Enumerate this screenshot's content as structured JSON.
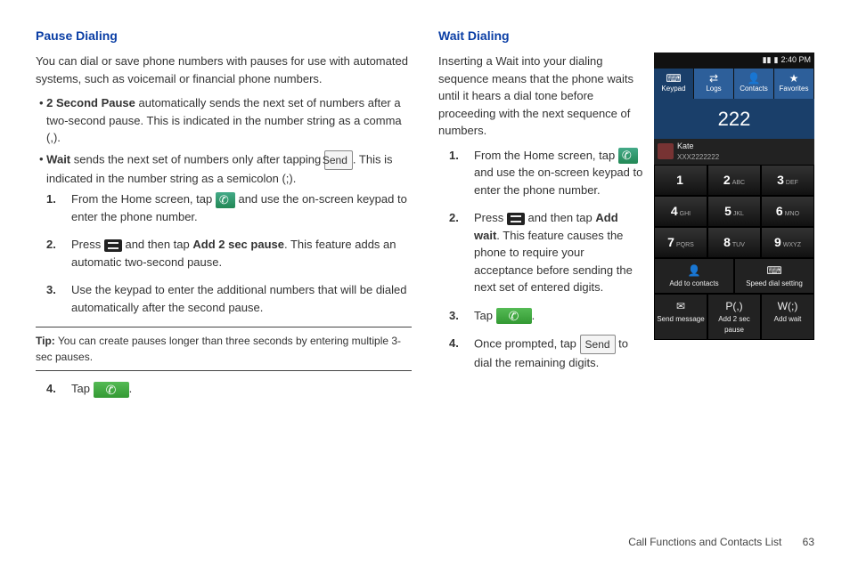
{
  "left": {
    "heading": "Pause Dialing",
    "intro": "You can dial or save phone numbers with pauses for use with automated systems, such as voicemail or financial phone numbers.",
    "b1_bold": "2 Second Pause",
    "b1_rest": " automatically sends the next set of numbers after a two-second pause. This is indicated in the number string as a comma (,).",
    "b2_bold": "Wait",
    "b2_rest_a": " sends the next set of numbers only after tapping ",
    "b2_rest_b": ". This is indicated in the number string as a semicolon (;).",
    "send": "Send",
    "s1_a": "From the Home screen, tap ",
    "s1_b": " and use the on-screen keypad to enter the phone number.",
    "s2_a": "Press ",
    "s2_b": " and then tap ",
    "s2_bold": "Add 2 sec pause",
    "s2_c": ". This feature adds an automatic two-second pause.",
    "s3": "Use the keypad to enter the additional numbers that will be dialed automatically after the second pause.",
    "tip_label": "Tip:",
    "tip": " You can create pauses longer than three seconds by entering multiple 3-sec pauses.",
    "s4_a": "Tap ",
    "s4_b": "."
  },
  "right": {
    "heading": "Wait Dialing",
    "intro": "Inserting a Wait into your dialing sequence means that the phone waits until it hears a dial tone before proceeding with the next sequence of numbers.",
    "s1_a": "From the Home screen, tap ",
    "s1_b": " and use the on-screen keypad to enter the phone number.",
    "s2_a": "Press ",
    "s2_b": " and then tap ",
    "s2_bold": "Add wait",
    "s2_c": ". This feature causes the phone to require your acceptance before sending the next set of entered digits.",
    "s3_a": "Tap ",
    "s3_b": ".",
    "s4_a": "Once prompted, tap ",
    "s4_b": " to dial the remaining digits.",
    "send": "Send"
  },
  "phone": {
    "time": "2:40 PM",
    "tabs": [
      "Keypad",
      "Logs",
      "Contacts",
      "Favorites"
    ],
    "tab_icons": [
      "⌨",
      "⇄",
      "👤",
      "★"
    ],
    "number": "222",
    "contact_name": "Kate",
    "contact_num": "XXX2222222",
    "keys": [
      {
        "d": "1",
        "l": ""
      },
      {
        "d": "2",
        "l": "ABC"
      },
      {
        "d": "3",
        "l": "DEF"
      },
      {
        "d": "4",
        "l": "GHI"
      },
      {
        "d": "5",
        "l": "JKL"
      },
      {
        "d": "6",
        "l": "MNO"
      },
      {
        "d": "7",
        "l": "PQRS"
      },
      {
        "d": "8",
        "l": "TUV"
      },
      {
        "d": "9",
        "l": "WXYZ"
      }
    ],
    "act1": "Add to contacts",
    "act2": "Speed dial setting",
    "act3a": "Send message",
    "act3b": "Add 2 sec pause",
    "act3c": "Add wait",
    "pw_a": "P(,)",
    "pw_b": "W(;)"
  },
  "footer": {
    "section": "Call Functions and Contacts List",
    "page": "63"
  }
}
